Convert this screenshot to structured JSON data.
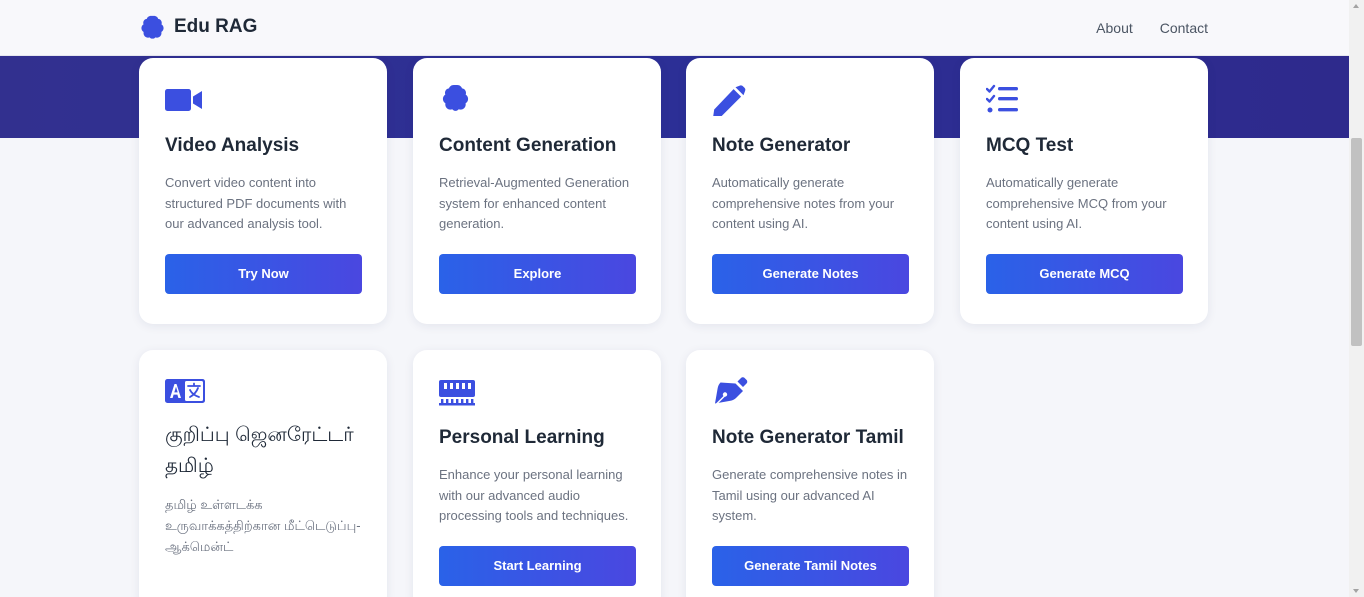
{
  "brand": {
    "name": "Edu RAG",
    "icon": "brain-icon"
  },
  "nav": {
    "about": "About",
    "contact": "Contact"
  },
  "colors": {
    "accent": "#3b4fe0",
    "hero": "#2e2f92",
    "button_start": "#2a62e8",
    "button_end": "#4a47e0"
  },
  "cards": [
    {
      "icon": "video-camera-icon",
      "title": "Video Analysis",
      "description": "Convert video content into structured PDF documents with our advanced analysis tool.",
      "button": "Try Now"
    },
    {
      "icon": "brain-icon",
      "title": "Content Generation",
      "description": "Retrieval-Augmented Generation system for enhanced content generation.",
      "button": "Explore"
    },
    {
      "icon": "pencil-icon",
      "title": "Note Generator",
      "description": "Automatically generate comprehensive notes from your content using AI.",
      "button": "Generate Notes"
    },
    {
      "icon": "checklist-icon",
      "title": "MCQ Test",
      "description": "Automatically generate comprehensive MCQ from your content using AI.",
      "button": "Generate MCQ"
    },
    {
      "icon": "language-icon",
      "title": "குறிப்பு ஜெனரேட்டர் தமிழ்",
      "description": "தமிழ் உள்ளடக்க உருவாக்கத்திற்கான மீட்டெடுப்பு-ஆக்மென்ட்"
    },
    {
      "icon": "audio-processing-icon",
      "title": "Personal Learning",
      "description": "Enhance your personal learning with our advanced audio processing tools and techniques.",
      "button": "Start Learning"
    },
    {
      "icon": "fountain-pen-icon",
      "title": "Note Generator Tamil",
      "description": "Generate comprehensive notes in Tamil using our advanced AI system.",
      "button": "Generate Tamil Notes"
    }
  ]
}
